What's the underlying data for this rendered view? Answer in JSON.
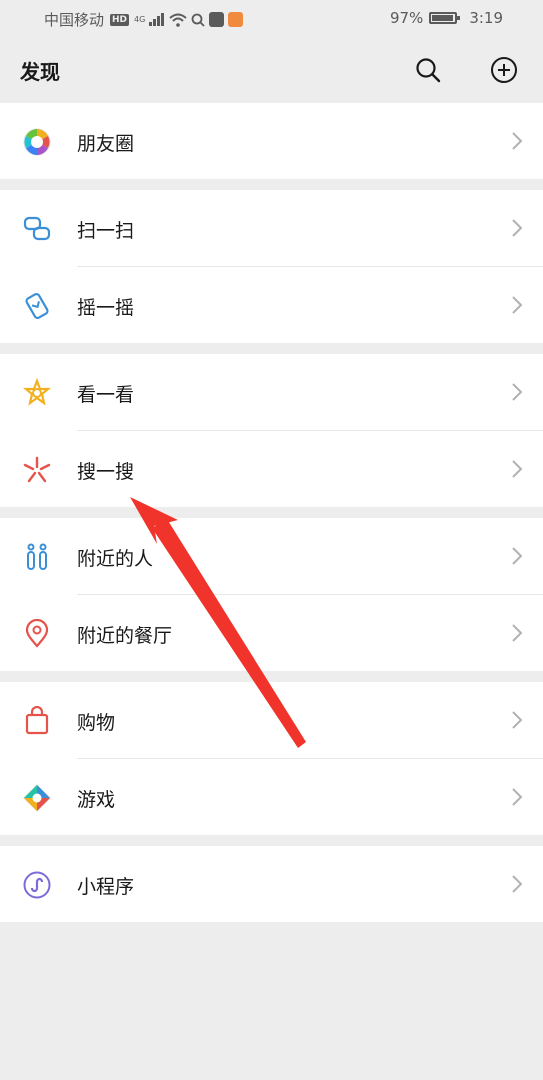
{
  "status_bar": {
    "carrier": "中国移动",
    "hd": "HD",
    "network": "4G",
    "battery_percent_text": "97%",
    "battery_level": 0.97,
    "time": "3:19"
  },
  "header": {
    "title": "发现",
    "search_icon": "search-icon",
    "add_icon": "plus-circle-icon"
  },
  "groups": [
    {
      "items": [
        {
          "label": "朋友圈",
          "icon": "moments-icon"
        }
      ]
    },
    {
      "items": [
        {
          "label": "扫一扫",
          "icon": "scan-icon"
        },
        {
          "label": "摇一摇",
          "icon": "shake-icon"
        }
      ]
    },
    {
      "items": [
        {
          "label": "看一看",
          "icon": "top-stories-icon"
        },
        {
          "label": "搜一搜",
          "icon": "search-spark-icon"
        }
      ]
    },
    {
      "items": [
        {
          "label": "附近的人",
          "icon": "people-nearby-icon"
        },
        {
          "label": "附近的餐厅",
          "icon": "location-pin-icon"
        }
      ]
    },
    {
      "items": [
        {
          "label": "购物",
          "icon": "shopping-bag-icon"
        },
        {
          "label": "游戏",
          "icon": "games-icon"
        }
      ]
    },
    {
      "items": [
        {
          "label": "小程序",
          "icon": "mini-programs-icon"
        }
      ]
    }
  ],
  "colors": {
    "background": "#ededed",
    "card": "#ffffff",
    "text": "#191919",
    "chevron": "#b2b2b2",
    "annotation_arrow": "#f0332b"
  }
}
